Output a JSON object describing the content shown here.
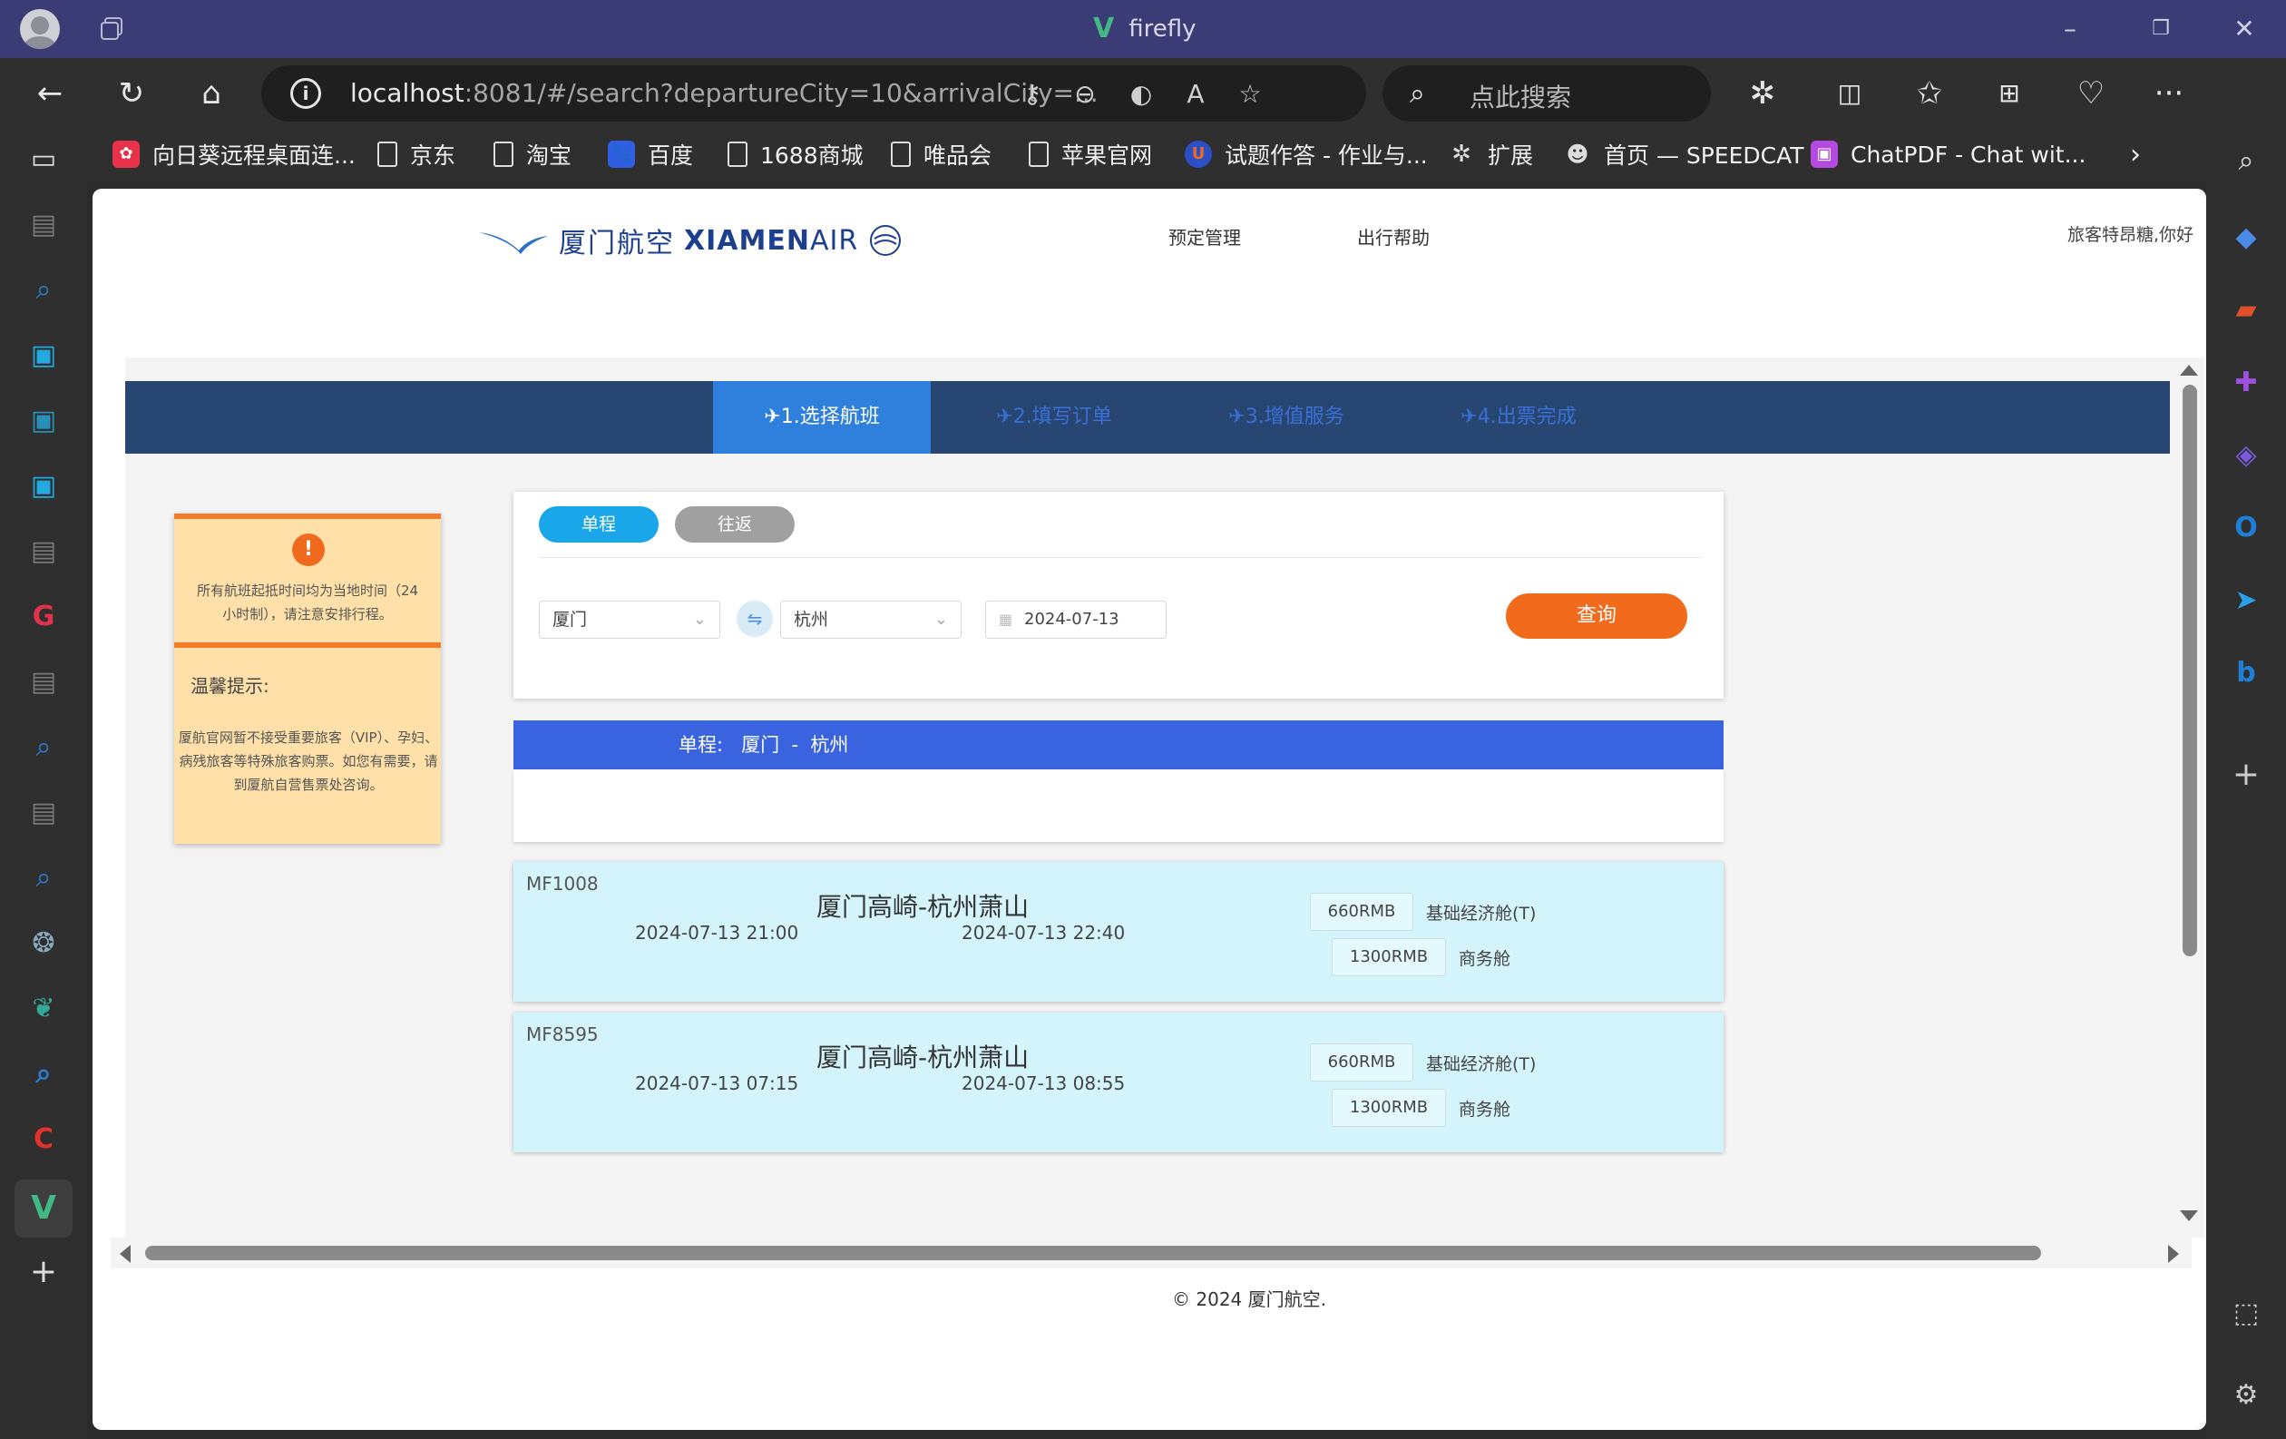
{
  "browser": {
    "window_title": "firefly",
    "url_host": "localhost",
    "url_rest": ":8081/#/search?departureCity=10&arrivalCity=...",
    "search_placeholder": "点此搜索"
  },
  "bookmarks": [
    {
      "label": "向日葵远程桌面连...",
      "icon": "sunflower-icon",
      "color": "#e8324a"
    },
    {
      "label": "京东",
      "icon": "page-icon",
      "color": ""
    },
    {
      "label": "淘宝",
      "icon": "page-icon",
      "color": ""
    },
    {
      "label": "百度",
      "icon": "baidu-icon",
      "color": "#2f5fe0"
    },
    {
      "label": "1688商城",
      "icon": "page-icon",
      "color": ""
    },
    {
      "label": "唯品会",
      "icon": "page-icon",
      "color": ""
    },
    {
      "label": "苹果官网",
      "icon": "page-icon",
      "color": ""
    },
    {
      "label": "试题作答 - 作业与...",
      "icon": "u-icon",
      "color": "#2b4fc7"
    },
    {
      "label": "扩展",
      "icon": "extension-icon",
      "color": ""
    },
    {
      "label": "首页 — SPEEDCAT",
      "icon": "speedcat-icon",
      "color": ""
    },
    {
      "label": "ChatPDF - Chat wit...",
      "icon": "chatpdf-icon",
      "color": "#b44ae0"
    }
  ],
  "site": {
    "logo_cn": "厦门航空",
    "logo_en_bold": "XIAMEN",
    "logo_en_thin": "AIR",
    "nav": [
      "预定管理",
      "出行帮助"
    ],
    "greeting": "旅客特昂糖,你好"
  },
  "steps": [
    {
      "label": "1.选择航班",
      "active": true
    },
    {
      "label": "2.填写订单",
      "active": false
    },
    {
      "label": "3.增值服务",
      "active": false
    },
    {
      "label": "4.出票完成",
      "active": false
    }
  ],
  "notice": {
    "top_text": "所有航班起抵时间均为当地时间（24小时制），请注意安排行程。",
    "heading": "温馨提示:",
    "body_text": "厦航官网暂不接受重要旅客（VIP）、孕妇、病残旅客等特殊旅客购票。如您有需要，请到厦航自营售票处咨询。"
  },
  "search": {
    "trip_types": [
      "单程",
      "往返"
    ],
    "departure": "厦门",
    "arrival": "杭州",
    "date": "2024-07-13",
    "query_label": "查询",
    "colors": {
      "one_way": "#1aa7ea",
      "round_trip": "#a0a0a0",
      "query": "#f26a1b"
    }
  },
  "route_banner": {
    "label": "单程:",
    "route": "厦门  -  杭州"
  },
  "flights": [
    {
      "number": "MF1008",
      "route": "厦门高崎-杭州萧山",
      "departure": "2024-07-13 21:00",
      "arrival": "2024-07-13 22:40",
      "fares": [
        {
          "price": "660RMB",
          "cabin": "基础经济舱(T)"
        },
        {
          "price": "1300RMB",
          "cabin": "商务舱"
        }
      ]
    },
    {
      "number": "MF8595",
      "route": "厦门高崎-杭州萧山",
      "departure": "2024-07-13 07:15",
      "arrival": "2024-07-13 08:55",
      "fares": [
        {
          "price": "660RMB",
          "cabin": "基础经济舱(T)"
        },
        {
          "price": "1300RMB",
          "cabin": "商务舱"
        }
      ]
    }
  ],
  "footer": "© 2024 厦门航空."
}
